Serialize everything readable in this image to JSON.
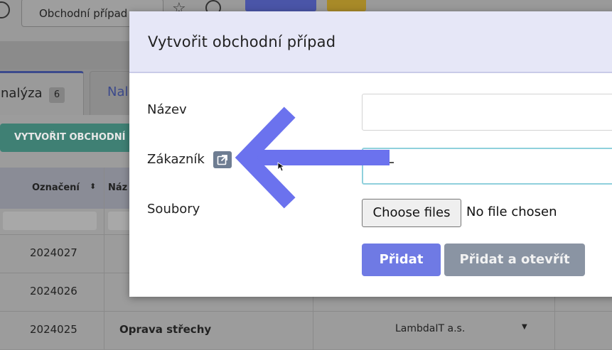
{
  "background": {
    "top_tab_label": "Obchodní případ",
    "tabs": [
      {
        "label": "nalýza",
        "count": "6"
      },
      {
        "label": "Nal"
      }
    ],
    "create_button_label": "VYTVOŘIT OBCHODNÍ P",
    "table": {
      "columns": [
        "Označení",
        "Náz"
      ],
      "rows": [
        {
          "id": "2024027",
          "name": "",
          "customer": ""
        },
        {
          "id": "2024026",
          "name": "",
          "customer": ""
        },
        {
          "id": "2024025",
          "name": "Oprava střechy",
          "customer": "LambdaIT a.s."
        }
      ]
    }
  },
  "modal": {
    "title": "Vytvořit obchodní případ",
    "fields": {
      "name_label": "Název",
      "name_value": "",
      "customer_label": "Zákazník",
      "customer_value": "",
      "files_label": "Soubory",
      "files_button": "Choose files",
      "files_status": "No file chosen"
    },
    "buttons": {
      "add": "Přidat",
      "add_and_open": "Přidat a otevřít"
    }
  },
  "colors": {
    "header_bg": "#e6e7f7",
    "primary_button": "#6f7ae4",
    "secondary_button": "#8a94a3",
    "arrow": "#6b72ee",
    "focus_border": "#8fd0dc"
  }
}
